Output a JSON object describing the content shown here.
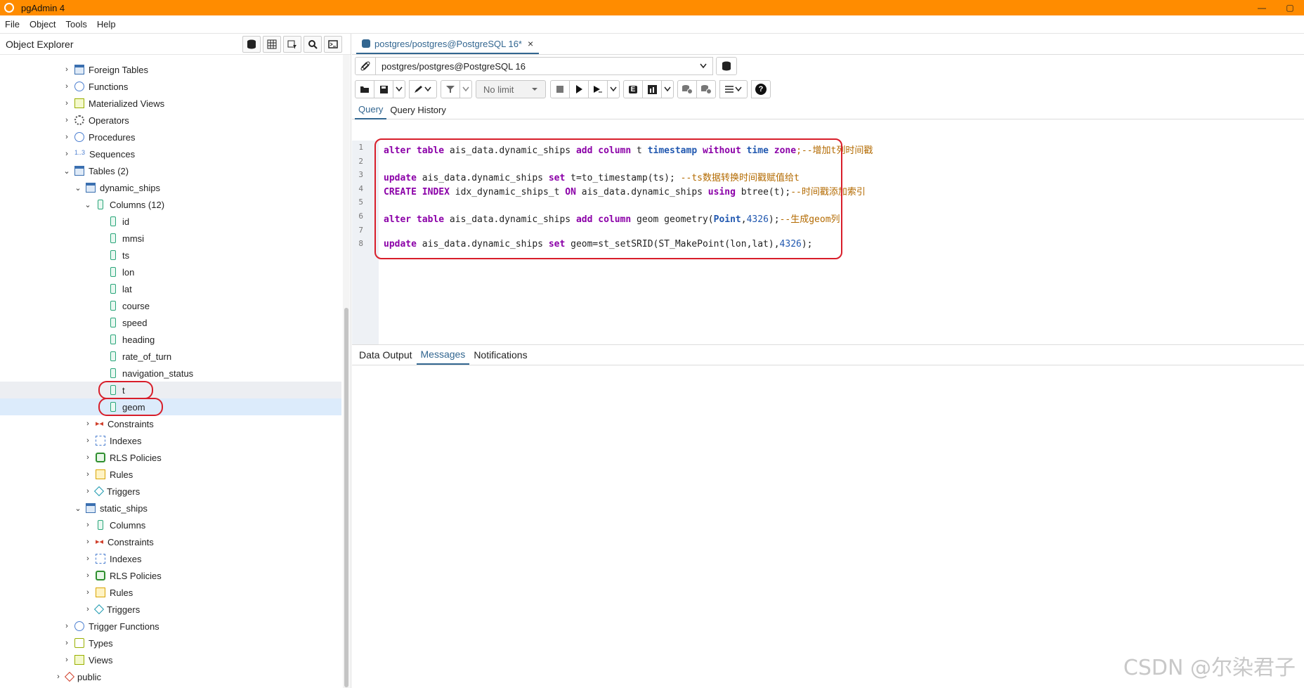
{
  "app": {
    "title": "pgAdmin 4"
  },
  "window_controls": {
    "minimize": "—",
    "maximize": "▢"
  },
  "menu": [
    "File",
    "Object",
    "Tools",
    "Help"
  ],
  "object_explorer": {
    "title": "Object Explorer",
    "tree": [
      {
        "label": "Foreign Tables",
        "icon": "table-icon"
      },
      {
        "label": "Functions",
        "icon": "function-icon"
      },
      {
        "label": "Materialized Views",
        "icon": "view-icon"
      },
      {
        "label": "Operators",
        "icon": "operator-icon"
      },
      {
        "label": "Procedures",
        "icon": "procedure-icon"
      },
      {
        "label": "Sequences",
        "icon": "sequence-icon",
        "glyph": "1..3"
      },
      {
        "label": "Tables (2)",
        "icon": "tables-icon"
      },
      {
        "label": "dynamic_ships",
        "icon": "table-icon"
      },
      {
        "label": "Columns (12)",
        "icon": "columns-icon"
      },
      {
        "label": "id",
        "icon": "column-icon"
      },
      {
        "label": "mmsi",
        "icon": "column-icon"
      },
      {
        "label": "ts",
        "icon": "column-icon"
      },
      {
        "label": "lon",
        "icon": "column-icon"
      },
      {
        "label": "lat",
        "icon": "column-icon"
      },
      {
        "label": "course",
        "icon": "column-icon"
      },
      {
        "label": "speed",
        "icon": "column-icon"
      },
      {
        "label": "heading",
        "icon": "column-icon"
      },
      {
        "label": "rate_of_turn",
        "icon": "column-icon"
      },
      {
        "label": "navigation_status",
        "icon": "column-icon"
      },
      {
        "label": "t",
        "icon": "column-icon"
      },
      {
        "label": "geom",
        "icon": "column-icon"
      },
      {
        "label": "Constraints",
        "icon": "constraints-icon",
        "glyph": "▸◂"
      },
      {
        "label": "Indexes",
        "icon": "indexes-icon"
      },
      {
        "label": "RLS Policies",
        "icon": "lock-icon"
      },
      {
        "label": "Rules",
        "icon": "rules-icon"
      },
      {
        "label": "Triggers",
        "icon": "trigger-icon"
      },
      {
        "label": "static_ships",
        "icon": "table-icon"
      },
      {
        "label": "Columns",
        "icon": "columns-icon"
      },
      {
        "label": "Constraints",
        "icon": "constraints-icon",
        "glyph": "▸◂"
      },
      {
        "label": "Indexes",
        "icon": "indexes-icon"
      },
      {
        "label": "RLS Policies",
        "icon": "lock-icon"
      },
      {
        "label": "Rules",
        "icon": "rules-icon"
      },
      {
        "label": "Triggers",
        "icon": "trigger-icon"
      },
      {
        "label": "Trigger Functions",
        "icon": "function-icon"
      },
      {
        "label": "Types",
        "icon": "types-icon"
      },
      {
        "label": "Views",
        "icon": "view-icon"
      },
      {
        "label": "public",
        "icon": "schema-icon"
      }
    ]
  },
  "query_tab": {
    "label": "postgres/postgres@PostgreSQL 16*",
    "close": "×",
    "connection": "postgres/postgres@PostgreSQL 16",
    "limit": "No limit",
    "subtabs": [
      "Query",
      "Query History"
    ],
    "explain_label": "E"
  },
  "editor": {
    "line_numbers": [
      "1",
      "2",
      "3",
      "4",
      "5",
      "6",
      "7",
      "8"
    ],
    "lines": [
      [
        {
          "t": "alter table",
          "c": "kw"
        },
        {
          "t": " ais_data.dynamic_ships ",
          "c": ""
        },
        {
          "t": "add column",
          "c": "kw"
        },
        {
          "t": " t ",
          "c": ""
        },
        {
          "t": "timestamp",
          "c": "kw2"
        },
        {
          "t": " ",
          "c": ""
        },
        {
          "t": "without",
          "c": "kw"
        },
        {
          "t": " ",
          "c": ""
        },
        {
          "t": "time",
          "c": "kw2"
        },
        {
          "t": " ",
          "c": ""
        },
        {
          "t": "zone",
          "c": "kw"
        },
        {
          "t": ";--增加t列时间戳",
          "c": "cm"
        }
      ],
      [],
      [
        {
          "t": "update",
          "c": "kw"
        },
        {
          "t": " ais_data.dynamic_ships ",
          "c": ""
        },
        {
          "t": "set",
          "c": "kw"
        },
        {
          "t": " t=to_timestamp(ts); ",
          "c": ""
        },
        {
          "t": "--ts数据转换时间戳赋值给t",
          "c": "cm"
        }
      ],
      [
        {
          "t": "CREATE INDEX",
          "c": "kw"
        },
        {
          "t": " idx_dynamic_ships_t ",
          "c": ""
        },
        {
          "t": "ON",
          "c": "kw"
        },
        {
          "t": " ais_data.dynamic_ships ",
          "c": ""
        },
        {
          "t": "using",
          "c": "kw"
        },
        {
          "t": " btree(t);",
          "c": ""
        },
        {
          "t": "--时间戳添加索引",
          "c": "cm"
        }
      ],
      [],
      [
        {
          "t": "alter table",
          "c": "kw"
        },
        {
          "t": " ais_data.dynamic_ships ",
          "c": ""
        },
        {
          "t": "add column",
          "c": "kw"
        },
        {
          "t": " geom geometry(",
          "c": ""
        },
        {
          "t": "Point",
          "c": "kw2"
        },
        {
          "t": ",",
          "c": ""
        },
        {
          "t": "4326",
          "c": "num"
        },
        {
          "t": ");",
          "c": ""
        },
        {
          "t": "--生成geom列",
          "c": "cm"
        }
      ],
      [],
      [
        {
          "t": "update",
          "c": "kw"
        },
        {
          "t": " ais_data.dynamic_ships ",
          "c": ""
        },
        {
          "t": "set",
          "c": "kw"
        },
        {
          "t": " geom=st_setSRID(ST_MakePoint(lon,lat),",
          "c": ""
        },
        {
          "t": "4326",
          "c": "num"
        },
        {
          "t": ");",
          "c": ""
        }
      ]
    ]
  },
  "result_tabs": [
    "Data Output",
    "Messages",
    "Notifications"
  ],
  "watermark": "CSDN @尔染君子",
  "colors": {
    "accent": "#326690",
    "titlebar": "#ff8c00",
    "highlight_oval": "#d81e2a"
  }
}
